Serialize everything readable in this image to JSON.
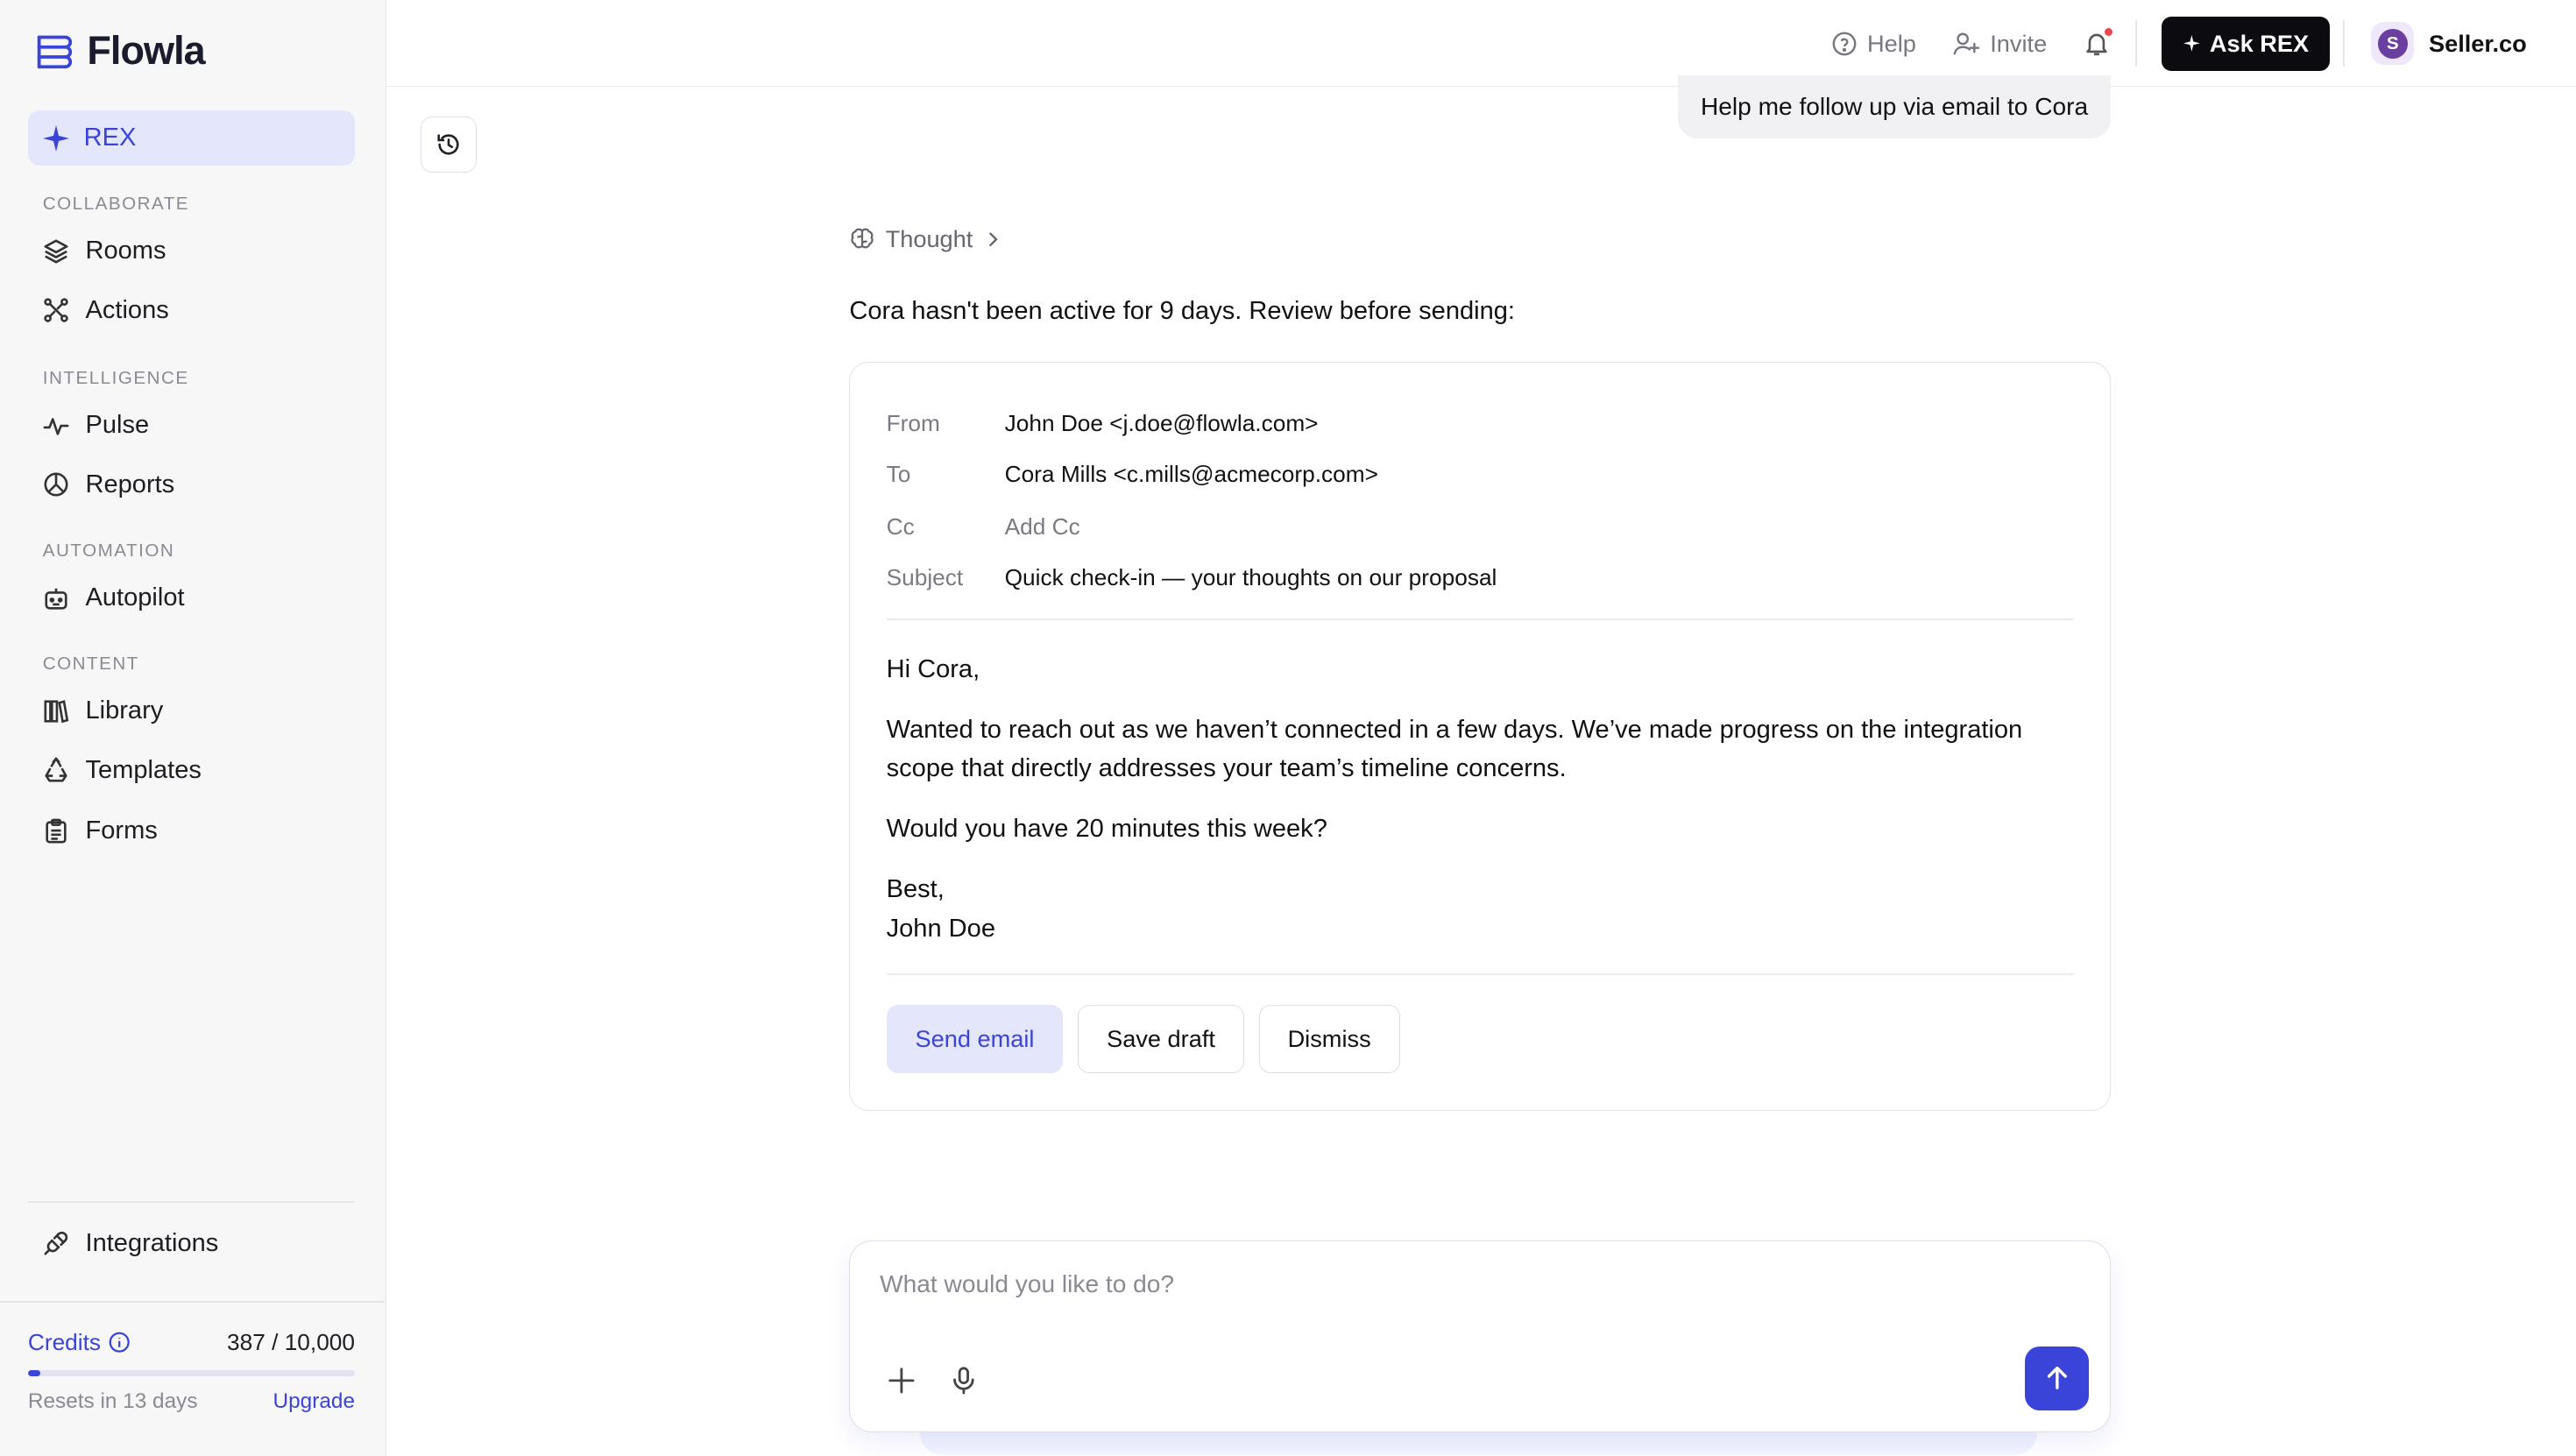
{
  "app": {
    "name": "Flowla"
  },
  "sidebar": {
    "rex_label": "REX",
    "sections": {
      "collaborate": "COLLABORATE",
      "intelligence": "INTELLIGENCE",
      "automation": "AUTOMATION",
      "content": "CONTENT"
    },
    "items": {
      "rooms": "Rooms",
      "actions": "Actions",
      "pulse": "Pulse",
      "reports": "Reports",
      "autopilot": "Autopilot",
      "library": "Library",
      "templates": "Templates",
      "forms": "Forms",
      "integrations": "Integrations"
    },
    "credits": {
      "label": "Credits",
      "value": "387 / 10,000",
      "used_fraction": 0.0387,
      "reset_text": "Resets in 13 days",
      "upgrade_label": "Upgrade"
    }
  },
  "topbar": {
    "help_label": "Help",
    "invite_label": "Invite",
    "ask_label": "Ask REX",
    "org_initial": "S",
    "org_name": "Seller.co"
  },
  "chat": {
    "user_message": "Help me follow up via email to Cora",
    "thought_label": "Thought",
    "intro": "Cora hasn't been active for 9 days. Review before sending:"
  },
  "email": {
    "from_label": "From",
    "from_value": "John Doe <j.doe@flowla.com>",
    "to_label": "To",
    "to_value": "Cora Mills <c.mills@acmecorp.com>",
    "cc_label": "Cc",
    "cc_value": "Add Cc",
    "subject_label": "Subject",
    "subject_value": "Quick check-in — your thoughts on our proposal",
    "greeting": "Hi Cora,",
    "para1": "Wanted to reach out as we haven’t connected in a few days. We’ve made progress on the integration scope that directly addresses your team’s timeline concerns.",
    "para2": "Would you have 20 minutes this week?",
    "signoff": "Best,",
    "signature": "John Doe",
    "send_label": "Send email",
    "save_label": "Save draft",
    "dismiss_label": "Dismiss"
  },
  "composer": {
    "placeholder": "What would you like to do?"
  },
  "colors": {
    "accent": "#3a44d8",
    "accent_soft": "#e4e6fb",
    "dark_button": "#0b0b10"
  }
}
